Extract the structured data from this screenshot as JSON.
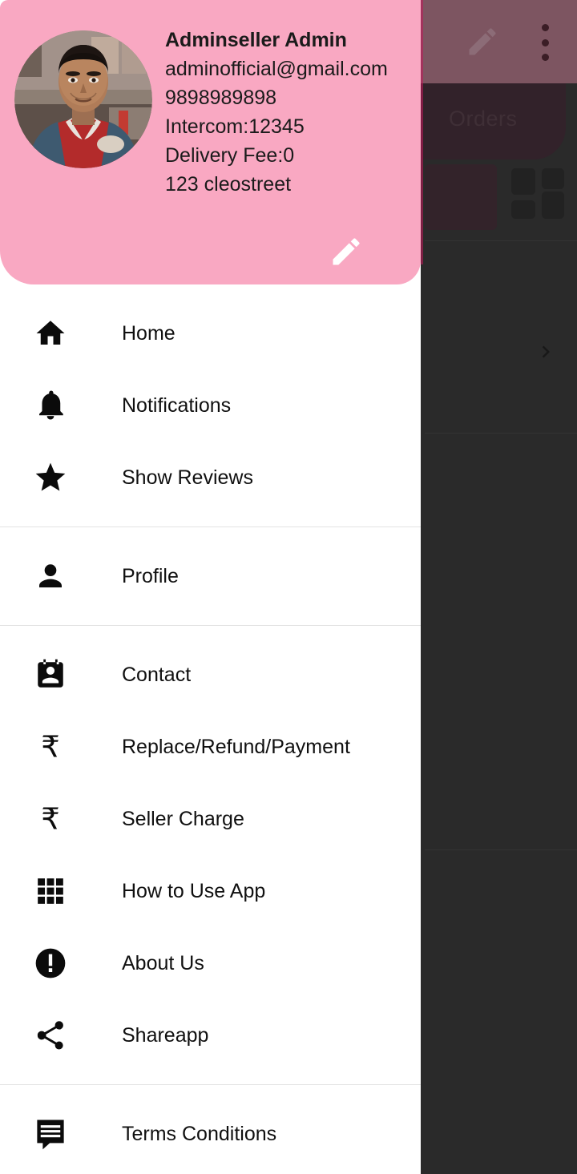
{
  "background": {
    "appbar": {
      "edit_icon": "edit-pencil-icon",
      "overflow_icon": "overflow-menu-icon"
    },
    "orders_card_label": "Orders",
    "chevron_icon": "chevron-right-icon"
  },
  "drawer": {
    "header": {
      "avatar_name": "user-avatar-photo",
      "name": "Adminseller Admin",
      "email": "adminofficial@gmail.com",
      "phone": "9898989898",
      "intercom": "Intercom:12345",
      "delivery_fee": "Delivery Fee:0",
      "address": "123 cleostreet",
      "edit_icon": "edit-pencil-icon",
      "background_color": "#f9a8c2"
    },
    "groups": [
      {
        "items": [
          {
            "label": "Home",
            "icon": "home-icon"
          },
          {
            "label": "Notifications",
            "icon": "bell-icon"
          },
          {
            "label": "Show Reviews",
            "icon": "star-icon"
          }
        ]
      },
      {
        "items": [
          {
            "label": "Profile",
            "icon": "person-icon"
          }
        ]
      },
      {
        "items": [
          {
            "label": "Contact",
            "icon": "contact-card-icon"
          },
          {
            "label": "Replace/Refund/Payment",
            "icon": "rupee-icon"
          },
          {
            "label": "Seller Charge",
            "icon": "rupee-icon"
          },
          {
            "label": "How to Use App",
            "icon": "grid-apps-icon"
          },
          {
            "label": "About Us",
            "icon": "info-exclamation-icon"
          },
          {
            "label": "Shareapp",
            "icon": "share-icon"
          }
        ]
      },
      {
        "items": [
          {
            "label": "Terms Conditions",
            "icon": "comment-icon"
          }
        ]
      }
    ]
  }
}
